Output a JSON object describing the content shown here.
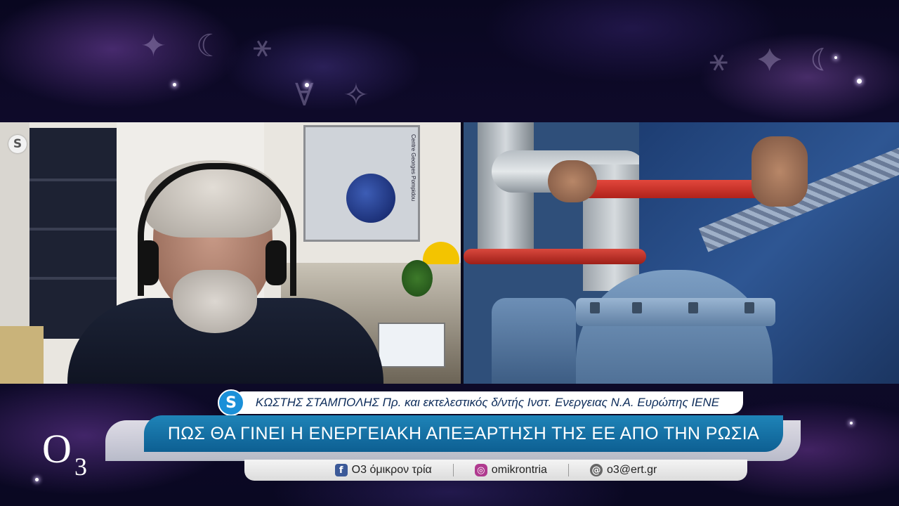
{
  "colors": {
    "headline_bg": "#1378ab",
    "name_text": "#0d2c5a",
    "skype_blue": "#1a90d8"
  },
  "icons": {
    "left_pane_badge": "skype-icon",
    "lower_third_badge": "skype-icon",
    "facebook": "facebook-icon",
    "instagram": "instagram-icon",
    "email": "at-sign-icon"
  },
  "lower_third": {
    "guest_name": "ΚΩΣΤΗΣ ΣΤΑΜΠΟΛΗΣ Πρ. και εκτελεστικός δ/ντής Ινστ. Ενεργειας Ν.Α. Ευρώπης ΙΕΝΕ",
    "headline": "ΠΩΣ ΘΑ ΓΙΝΕΙ Η ΕΝΕΡΓΕΙΑΚΗ ΑΠΕΞΑΡΤΗΣΗ ΤΗΣ ΕΕ ΑΠΟ ΤΗΝ ΡΩΣΙΑ"
  },
  "social": {
    "facebook": "Ο3 όμικρον τρία",
    "instagram": "omikrontria",
    "email": "o3@ert.gr"
  },
  "logo": {
    "letter": "O",
    "subscript": "3"
  },
  "badges": {
    "skype_glyph": "S"
  },
  "poster": {
    "caption": "Centre Georges Pompidou"
  }
}
